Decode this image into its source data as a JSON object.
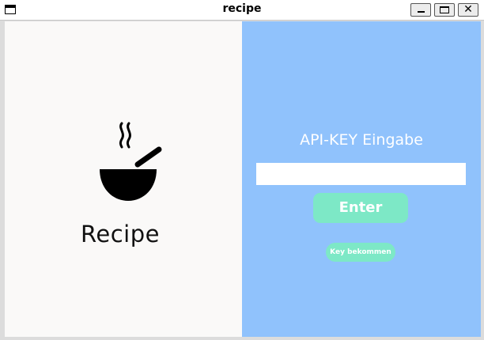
{
  "window": {
    "title": "recipe",
    "close_glyph": "✕"
  },
  "left": {
    "logo_text": "Recipe",
    "logo_icon": "soup-bowl-icon"
  },
  "right": {
    "heading": "API-KEY Eingabe",
    "input_value": "",
    "enter_label": "Enter",
    "key_link_label": "Key bekommen"
  },
  "colors": {
    "left_panel_bg": "#faf9f8",
    "right_panel_bg": "#90c2fc",
    "button_bg": "#7de8c6",
    "button_text": "#ffffff"
  }
}
